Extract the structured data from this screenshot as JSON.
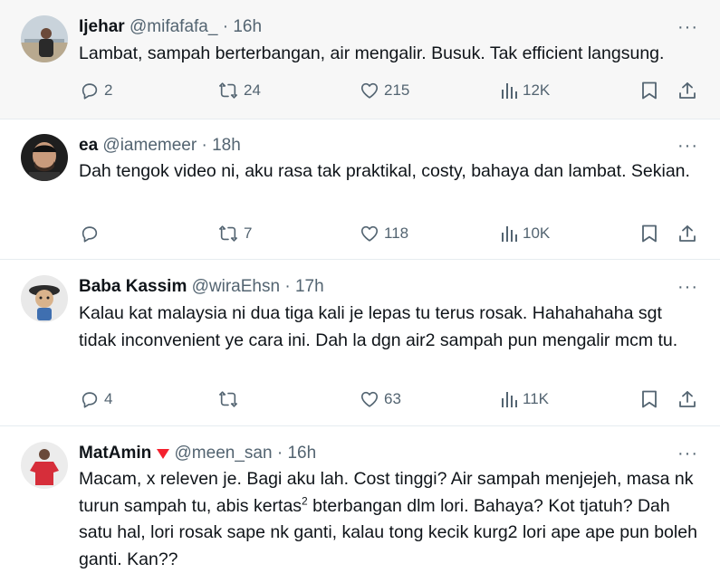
{
  "tweets": [
    {
      "name": "Ijehar",
      "handle": "@mifafafa_",
      "dot": "·",
      "time": "16h",
      "text": "Lambat, sampah berterbangan, air mengalir. Busuk. Tak efficient langsung.",
      "replies": "2",
      "reposts": "24",
      "likes": "215",
      "views": "12K"
    },
    {
      "name": "ea",
      "handle": "@iamemeer",
      "dot": "·",
      "time": "18h",
      "text": "Dah tengok video ni, aku rasa tak praktikal, costy, bahaya dan lambat. Sekian.",
      "replies": "",
      "reposts": "7",
      "likes": "118",
      "views": "10K"
    },
    {
      "name": "Baba Kassim",
      "handle": "@wiraEhsn",
      "dot": "·",
      "time": "17h",
      "text": "Kalau kat malaysia ni dua tiga kali je lepas tu terus rosak. Hahahahaha sgt tidak inconvenient ye cara ini. Dah la dgn air2 sampah pun mengalir mcm tu.",
      "replies": "4",
      "reposts": "",
      "likes": "63",
      "views": "11K"
    },
    {
      "name": "MatAmin",
      "handle": "@meen_san",
      "dot": "·",
      "time": "16h",
      "text_a": "Macam, x releven je. Bagi aku lah. Cost tinggi? Air sampah menjejeh, masa nk turun sampah tu, abis kertas",
      "text_sup": "2",
      "text_b": " bterbangan dlm lori. Bahaya? Kot tjatuh? Dah satu hal, lori rosak sape nk ganti, kalau tong kecik kurg2 lori ape ape pun boleh ganti. Kan??"
    }
  ],
  "more_glyph": "···",
  "icons": [
    "reply-icon",
    "repost-icon",
    "like-icon",
    "views-icon",
    "bookmark-icon",
    "share-icon",
    "more-icon",
    "red-heart-icon"
  ],
  "colors": {
    "text": "#0f1419",
    "muted": "#536471",
    "border": "#e6ecf0",
    "heart": "#f4212e",
    "highlight": "#f7f7f7"
  }
}
